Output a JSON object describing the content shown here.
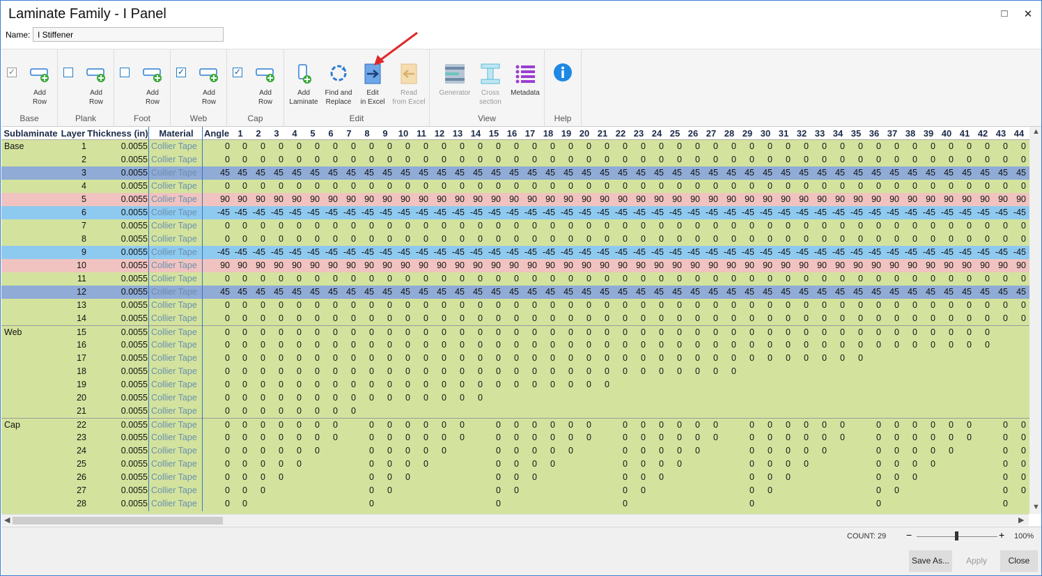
{
  "window": {
    "title": "Laminate Family - I Panel",
    "maximize_icon": "□",
    "close_icon": "✕"
  },
  "name_field": {
    "label": "Name:",
    "value": "I Stiffener"
  },
  "ribbon": {
    "groups": [
      {
        "label": "Base",
        "checked": true,
        "button": "Add\nRow"
      },
      {
        "label": "Plank",
        "checked": false,
        "button": "Add\nRow"
      },
      {
        "label": "Foot",
        "checked": false,
        "button": "Add\nRow"
      },
      {
        "label": "Web",
        "checked": true,
        "button": "Add\nRow"
      },
      {
        "label": "Cap",
        "checked": true,
        "button": "Add\nRow"
      }
    ],
    "edit": {
      "label": "Edit",
      "add_laminate": "Add\nLaminate",
      "find_replace": "Find and\nReplace",
      "edit_excel": "Edit\nin Excel",
      "read_excel": "Read\nfrom Excel"
    },
    "view": {
      "label": "View",
      "generator": "Generator",
      "cross_section": "Cross\nsection",
      "metadata": "Metadata"
    },
    "help": {
      "label": "Help"
    }
  },
  "table": {
    "headers": {
      "sublaminate": "Sublaminate",
      "layer": "Layer",
      "thickness": "Thickness (in)",
      "material": "Material",
      "angle": "Angle"
    },
    "ply_count": 44,
    "material": "Collier Tape",
    "thickness": "0.0055",
    "colors": {
      "green": "#d3e39e",
      "dark_blue": "#8fabd6",
      "pink": "#f0c3c0",
      "light_blue": "#8ec9ef"
    },
    "rows": [
      {
        "sub": "Base",
        "layer": "1",
        "angle": "0",
        "color": "green",
        "n": 44
      },
      {
        "sub": "",
        "layer": "2",
        "angle": "0",
        "color": "green",
        "n": 44
      },
      {
        "sub": "",
        "layer": "3",
        "angle": "45",
        "color": "dark_blue",
        "n": 44
      },
      {
        "sub": "",
        "layer": "4",
        "angle": "0",
        "color": "green",
        "n": 44
      },
      {
        "sub": "",
        "layer": "5",
        "angle": "90",
        "color": "pink",
        "n": 44
      },
      {
        "sub": "",
        "layer": "6",
        "angle": "-45",
        "color": "light_blue",
        "n": 44
      },
      {
        "sub": "",
        "layer": "7",
        "angle": "0",
        "color": "green",
        "n": 44
      },
      {
        "sub": "",
        "layer": "8",
        "angle": "0",
        "color": "green",
        "n": 44
      },
      {
        "sub": "",
        "layer": "9",
        "angle": "-45",
        "color": "light_blue",
        "n": 44
      },
      {
        "sub": "",
        "layer": "10",
        "angle": "90",
        "color": "pink",
        "n": 44
      },
      {
        "sub": "",
        "layer": "11",
        "angle": "0",
        "color": "green",
        "n": 44
      },
      {
        "sub": "",
        "layer": "12",
        "angle": "45",
        "color": "dark_blue",
        "n": 44
      },
      {
        "sub": "",
        "layer": "13",
        "angle": "0",
        "color": "green",
        "n": 44
      },
      {
        "sub": "",
        "layer": "14",
        "angle": "0",
        "color": "green",
        "n": 44
      },
      {
        "sub": "Web",
        "layer": "15",
        "angle": "0",
        "color": "green",
        "n": 42
      },
      {
        "sub": "",
        "layer": "16",
        "angle": "0",
        "color": "green",
        "n": 42
      },
      {
        "sub": "",
        "layer": "17",
        "angle": "0",
        "color": "green",
        "n": 35
      },
      {
        "sub": "",
        "layer": "18",
        "angle": "0",
        "color": "green",
        "n": 28
      },
      {
        "sub": "",
        "layer": "19",
        "angle": "0",
        "color": "green",
        "n": 21
      },
      {
        "sub": "",
        "layer": "20",
        "angle": "0",
        "color": "green",
        "n": 14
      },
      {
        "sub": "",
        "layer": "21",
        "angle": "0",
        "color": "green",
        "n": 7
      },
      {
        "sub": "Cap",
        "layer": "22",
        "angle": "0",
        "color": "green",
        "groups": 6
      },
      {
        "sub": "",
        "layer": "23",
        "angle": "0",
        "color": "green",
        "groups": 5
      },
      {
        "sub": "",
        "layer": "24",
        "angle": "0",
        "color": "green",
        "groups": 4
      },
      {
        "sub": "",
        "layer": "25",
        "angle": "0",
        "color": "green",
        "groups": 3
      },
      {
        "sub": "",
        "layer": "26",
        "angle": "0",
        "color": "green",
        "groups": 2
      },
      {
        "sub": "",
        "layer": "27",
        "angle": "0",
        "color": "green",
        "groups": 1
      },
      {
        "sub": "",
        "layer": "28",
        "angle": "0",
        "color": "green",
        "groups": 0
      }
    ]
  },
  "status": {
    "count": "COUNT: 29",
    "zoom": "100%",
    "zoom_out": "−",
    "zoom_in": "+"
  },
  "buttons": {
    "save_as": "Save As...",
    "apply": "Apply",
    "close": "Close"
  }
}
